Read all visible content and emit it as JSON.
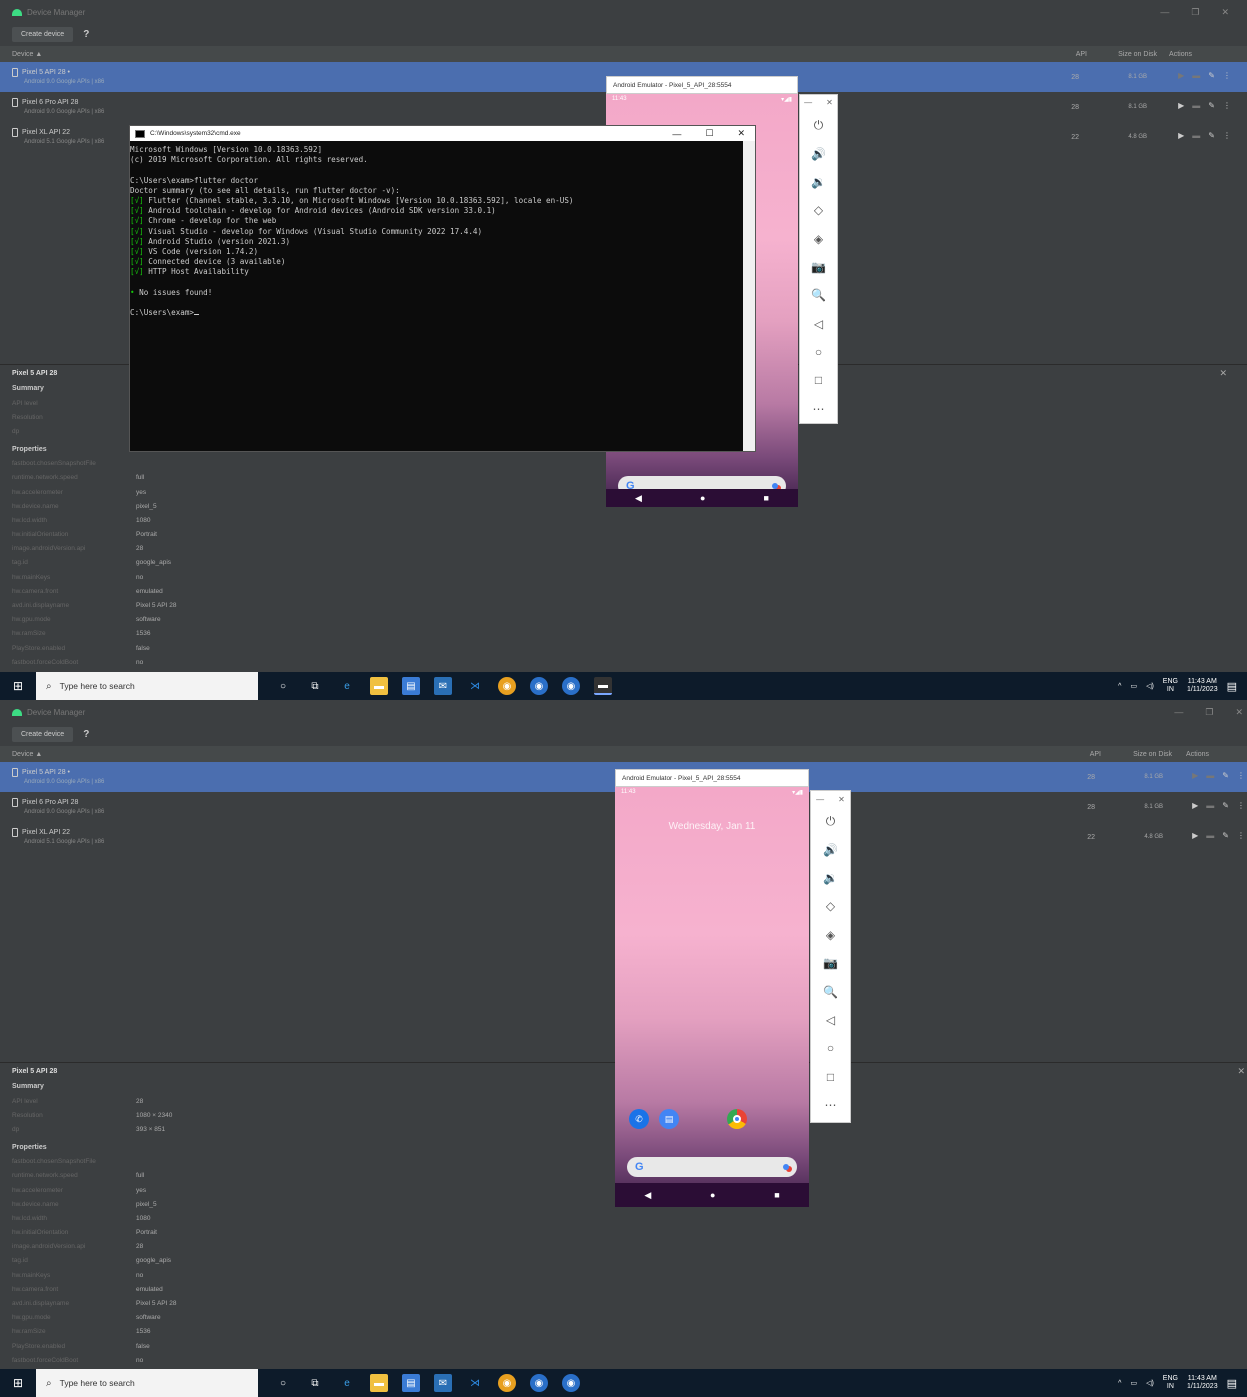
{
  "device_manager": {
    "title": "Device Manager",
    "window_controls": [
      "—",
      "❐",
      "✕"
    ],
    "create_device": "Create device",
    "help": "?",
    "columns": {
      "device": "Device ▲",
      "api": "API",
      "size": "Size on Disk",
      "actions": "Actions"
    },
    "devices": [
      {
        "name": "Pixel 5 API 28 •",
        "sub": "Android 9.0 Google APIs | x86",
        "api": "28",
        "size": "8.1 GB"
      },
      {
        "name": "Pixel 6 Pro API 28",
        "sub": "Android 9.0 Google APIs | x86",
        "api": "28",
        "size": "8.1 GB"
      },
      {
        "name": "Pixel XL API 22",
        "sub": "Android 5.1 Google APIs | x86",
        "api": "22",
        "size": "4.8 GB"
      }
    ]
  },
  "details": {
    "title": "Pixel 5 API 28",
    "close": "✕",
    "summary_label": "Summary",
    "summary": [
      {
        "k": "API level",
        "v": "",
        "v2": "28"
      },
      {
        "k": "Resolution",
        "v": "",
        "v2": "1080 × 2340"
      },
      {
        "k": "dp",
        "v": "",
        "v2": "393 × 851"
      }
    ],
    "properties_label": "Properties",
    "properties": [
      {
        "k": "fastboot.chosenSnapshotFile",
        "v": ""
      },
      {
        "k": "runtime.network.speed",
        "v": "full"
      },
      {
        "k": "hw.accelerometer",
        "v": "yes"
      },
      {
        "k": "hw.device.name",
        "v": "pixel_5"
      },
      {
        "k": "hw.lcd.width",
        "v": "1080"
      },
      {
        "k": "hw.initialOrientation",
        "v": "Portrait"
      },
      {
        "k": "image.androidVersion.api",
        "v": "28"
      },
      {
        "k": "tag.id",
        "v": "google_apis"
      },
      {
        "k": "hw.mainKeys",
        "v": "no"
      },
      {
        "k": "hw.camera.front",
        "v": "emulated"
      },
      {
        "k": "avd.ini.displayname",
        "v": "Pixel 5 API 28"
      },
      {
        "k": "hw.gpu.mode",
        "v": "software"
      },
      {
        "k": "hw.ramSize",
        "v": "1536"
      },
      {
        "k": "PlayStore.enabled",
        "v": "false"
      },
      {
        "k": "fastboot.forceColdBoot",
        "v": "no"
      }
    ]
  },
  "emulator": {
    "title": "Android Emulator - Pixel_5_API_28:5554",
    "time": "11:43",
    "date": "Wednesday, Jan 11",
    "window_controls": [
      "—",
      "✕"
    ],
    "controls": [
      "⏻",
      "🔊",
      "🔉",
      "◇",
      "◈",
      "📷",
      "🔍",
      "◁",
      "○",
      "□",
      "⋯"
    ],
    "nav": [
      "◀",
      "●",
      "■"
    ]
  },
  "cmd": {
    "title": "C:\\Windows\\system32\\cmd.exe",
    "controls": [
      "—",
      "☐",
      "✕"
    ],
    "lines": [
      {
        "t": "Microsoft Windows [Version 10.0.18363.592]"
      },
      {
        "t": "(c) 2019 Microsoft Corporation. All rights reserved."
      },
      {
        "t": ""
      },
      {
        "t": "C:\\Users\\exam>flutter doctor"
      },
      {
        "t": "Doctor summary (to see all details, run flutter doctor -v):"
      },
      {
        "ok": "[√]",
        "t": " Flutter (Channel stable, 3.3.10, on Microsoft Windows [Version 10.0.18363.592], locale en-US)"
      },
      {
        "ok": "[√]",
        "t": " Android toolchain - develop for Android devices (Android SDK version 33.0.1)"
      },
      {
        "ok": "[√]",
        "t": " Chrome - develop for the web"
      },
      {
        "ok": "[√]",
        "t": " Visual Studio - develop for Windows (Visual Studio Community 2022 17.4.4)"
      },
      {
        "ok": "[√]",
        "t": " Android Studio (version 2021.3)"
      },
      {
        "ok": "[√]",
        "t": " VS Code (version 1.74.2)"
      },
      {
        "ok": "[√]",
        "t": " Connected device (3 available)"
      },
      {
        "ok": "[√]",
        "t": " HTTP Host Availability"
      },
      {
        "t": ""
      },
      {
        "ok": "•",
        "t": " No issues found!"
      },
      {
        "t": ""
      },
      {
        "t": "C:\\Users\\exam>"
      }
    ]
  },
  "taskbar": {
    "search_placeholder": "Type here to search",
    "lang": "ENG",
    "region": "IN",
    "time": "11:43 AM",
    "date": "1/11/2023"
  }
}
